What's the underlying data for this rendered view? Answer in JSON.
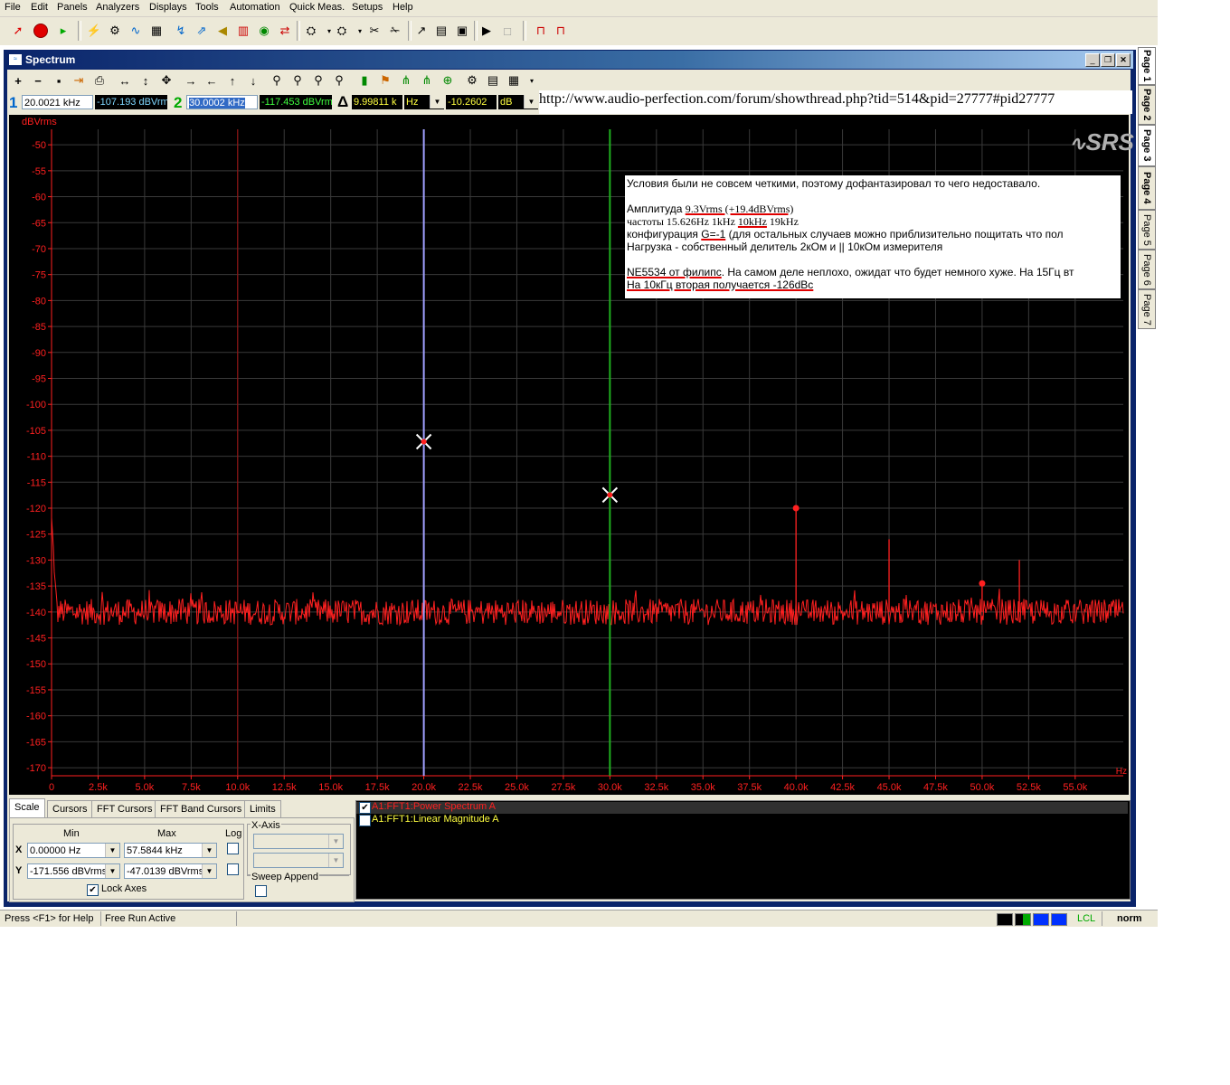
{
  "menu": [
    "File",
    "Edit",
    "Panels",
    "Analyzers",
    "Displays",
    "Tools",
    "Automation",
    "Quick Meas.",
    "Setups",
    "Help"
  ],
  "window": {
    "title": "Spectrum"
  },
  "readout": {
    "c1_num": "1",
    "c1_freq": "20.0021 kHz",
    "c1_level": "-107.193 dBVrm",
    "c2_num": "2",
    "c2_freq": "30.0002 kHz",
    "c2_level": "-117.453 dBVrm",
    "delta_sym": "Δ",
    "delta_freq": "9.99811 k",
    "delta_freq_unit": "Hz",
    "delta_level": "-10.2602",
    "delta_level_unit": "dB"
  },
  "url": "http://www.audio-perfection.com/forum/showthread.php?tid=514&pid=27777#pid27777",
  "note": {
    "line1": "Условия были не совсем четкими, поэтому дофантазировал то чего недоставало.",
    "line2a": "Амплитуда ",
    "line2b": "9.3Vrms (+19.4dBVrms)",
    "line3a": "частоты 15.626Hz 1kHz ",
    "line3b": "10kHz",
    "line3c": " 19kHz",
    "line4a": "конфигурация ",
    "line4b": "G=-1",
    "line4c": " (для остальных случаев можно приблизительно пощитать что пол",
    "line5": "Нагрузка - собственный делитель 2кОм и || 10кОм измерителя",
    "line6a": "NE5534 от филипс",
    "line6b": ". На самом деле неплохо, ожидат что будет немного хуже. На 15Гц вт",
    "line7": "На 10кГц вторая получается -126dBc"
  },
  "chart_data": {
    "type": "line",
    "title": "",
    "ylabel": "dBVrms",
    "xlabel": "Hz",
    "xlim": [
      0,
      57584.4
    ],
    "ylim": [
      -171.556,
      -47.0139
    ],
    "x_ticks": [
      "0",
      "2.5k",
      "5.0k",
      "7.5k",
      "10.0k",
      "12.5k",
      "15.0k",
      "17.5k",
      "20.0k",
      "22.5k",
      "25.0k",
      "27.5k",
      "30.0k",
      "32.5k",
      "35.0k",
      "37.5k",
      "40.0k",
      "42.5k",
      "45.0k",
      "47.5k",
      "50.0k",
      "52.5k",
      "55.0k"
    ],
    "x_tick_values": [
      0,
      2500,
      5000,
      7500,
      10000,
      12500,
      15000,
      17500,
      20000,
      22500,
      25000,
      27500,
      30000,
      32500,
      35000,
      37500,
      40000,
      42500,
      45000,
      47500,
      50000,
      52500,
      55000
    ],
    "y_ticks": [
      -50,
      -55,
      -60,
      -65,
      -70,
      -75,
      -80,
      -85,
      -90,
      -95,
      -100,
      -105,
      -110,
      -115,
      -120,
      -125,
      -130,
      -135,
      -140,
      -145,
      -150,
      -155,
      -160,
      -165,
      -170
    ],
    "series": [
      {
        "color": "#ff2020",
        "noise_floor": -140,
        "peaks": [
          [
            10000,
            -140
          ],
          [
            20000,
            -107
          ],
          [
            30000,
            -117
          ],
          [
            40000,
            -120
          ],
          [
            45000,
            -126
          ],
          [
            50000,
            -135
          ],
          [
            52000,
            -130
          ]
        ]
      }
    ],
    "cursors": [
      {
        "x": 20002.1,
        "y": -107.193,
        "color": "#a0a0ff"
      },
      {
        "x": 30000.2,
        "y": -117.453,
        "color": "#20b020"
      }
    ],
    "reference_line_x": 10000,
    "marker_dots": [
      [
        40000,
        -120
      ],
      [
        50000,
        -134.5
      ]
    ]
  },
  "tabs": [
    "Scale",
    "Cursors",
    "FFT Cursors",
    "FFT Band Cursors",
    "Limits"
  ],
  "scale": {
    "min_label": "Min",
    "max_label": "Max",
    "log_label": "Log",
    "x_label": "X",
    "y_label": "Y",
    "x_min": "0.00000 Hz",
    "x_max": "57.5844 kHz",
    "y_min": "-171.556 dBVrms",
    "y_max": "-47.0139 dBVrms",
    "lock_axes": "Lock Axes",
    "xaxis_group": "X-Axis",
    "sweep_append": "Sweep Append"
  },
  "traces": [
    {
      "label": "A1:FFT1:Power Spectrum A",
      "color": "#ff2020",
      "checked": true
    },
    {
      "label": "A1:FFT1:Linear Magnitude A",
      "color": "#ffff40",
      "checked": false
    }
  ],
  "status": {
    "help": "Press <F1> for Help",
    "run": "Free Run Active",
    "lcl": "LCL",
    "norm": "norm"
  },
  "pages": [
    "Page 1",
    "Page 2",
    "Page 3",
    "Page 4",
    "Page 5",
    "Page 6",
    "Page 7"
  ],
  "logo": "SRS"
}
